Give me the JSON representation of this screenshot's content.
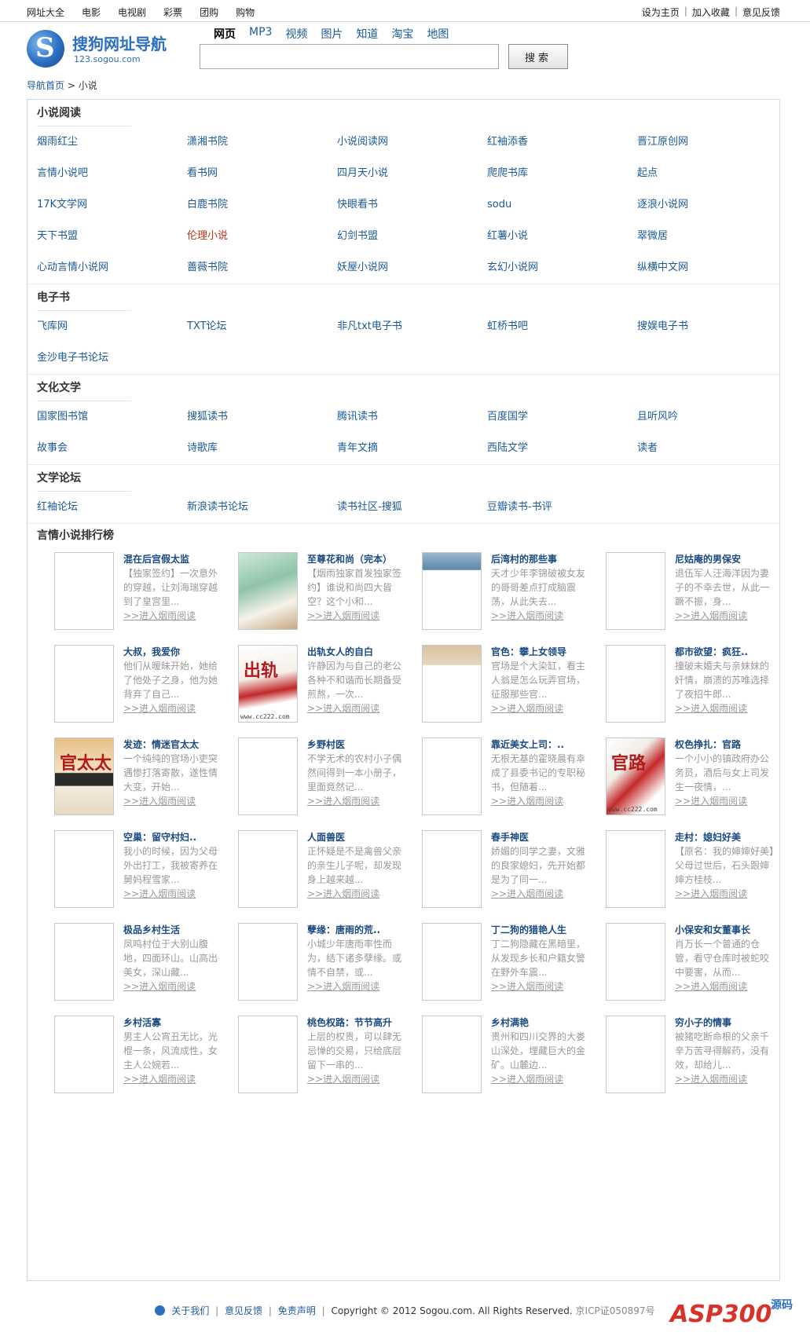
{
  "topnav": {
    "left": [
      "网址大全",
      "电影",
      "电视剧",
      "彩票",
      "团购",
      "购物"
    ],
    "right": [
      "设为主页",
      "加入收藏",
      "意见反馈"
    ],
    "separator": "|"
  },
  "logo": {
    "brand": "搜狗网址导航",
    "domain": "123.sogou.com",
    "glyph": "S"
  },
  "search": {
    "tabs": [
      "网页",
      "MP3",
      "视频",
      "图片",
      "知道",
      "淘宝",
      "地图"
    ],
    "active_tab": "网页",
    "value": "",
    "button": "搜索"
  },
  "breadcrumb": {
    "home": "导航首页",
    "arrow": ">",
    "current": "小说"
  },
  "sections": [
    {
      "title": "小说阅读",
      "links": [
        "烟雨红尘",
        "潇湘书院",
        "小说阅读网",
        "红袖添香",
        "晋江原创网",
        "言情小说吧",
        "看书网",
        "四月天小说",
        "爬爬书库",
        "起点",
        "17K文学网",
        "白鹿书院",
        "快眼看书",
        "sodu",
        "逐浪小说网",
        "天下书盟",
        "伦理小说",
        "幻剑书盟",
        "红薯小说",
        "翠微居",
        "心动言情小说网",
        "蔷薇书院",
        "妖屋小说网",
        "玄幻小说网",
        "纵横中文网"
      ],
      "hot": [
        16
      ]
    },
    {
      "title": "电子书",
      "links": [
        "飞库网",
        "TXT论坛",
        "非凡txt电子书",
        "虹桥书吧",
        "搜娱电子书",
        "金沙电子书论坛"
      ],
      "hot": []
    },
    {
      "title": "文化文学",
      "links": [
        "国家图书馆",
        "搜狐读书",
        "腾讯读书",
        "百度国学",
        "且听风吟",
        "故事会",
        "诗歌库",
        "青年文摘",
        "西陆文学",
        "读者"
      ],
      "hot": []
    },
    {
      "title": "文学论坛",
      "links": [
        "红袖论坛",
        "新浪读书论坛",
        "读书社区-搜狐",
        "豆瓣读书-书评"
      ],
      "hot": []
    }
  ],
  "ranking": {
    "title": "言情小说排行榜",
    "more_label": ">>进入烟雨阅读",
    "books": [
      {
        "title": "混在后宫假太监",
        "desc": "【独家签约】一次意外的穿越，让刘海瑞穿越到了皇宫里...",
        "cover": ""
      },
      {
        "title": "至尊花和尚（完本）",
        "desc": "【烟雨独家首发独家签约】谁说和尚四大皆空？这个小和...",
        "cover": "img-a"
      },
      {
        "title": "后湾村的那些事",
        "desc": "天才少年李锦破被女友的哥哥差点打成脑震荡，从此失去...",
        "cover": "img-b"
      },
      {
        "title": "尼姑庵的男保安",
        "desc": "退伍军人汪海洋因为妻子的不幸去世，从此一蹶不振，身...",
        "cover": ""
      },
      {
        "title": "大叔，我爱你",
        "desc": "他们从暧昧开始，她给了他处子之身，他为她背弃了自己...",
        "cover": ""
      },
      {
        "title": "出轨女人的自白",
        "desc": "许静因为与自己的老公各种不和谐而长期备受煎熬，一次...",
        "cover": "img-c",
        "label": "www.cc222.com",
        "mark": "出轨"
      },
      {
        "title": "官色：攀上女领导",
        "desc": "官场是个大染缸，看主人翁是怎么玩弄官场，征服那些官...",
        "cover": "img-d"
      },
      {
        "title": "都市欲望：疯狂..",
        "desc": "撞破未婚夫与亲妹妹的奸情，崩溃的苏唯选择了夜招牛郎...",
        "cover": ""
      },
      {
        "title": "发迹：情迷官太太",
        "desc": "一个纯纯的官场小吏突遇惨打落寄散，遂性情大变，开始...",
        "cover": "img-e",
        "mark": "官太太"
      },
      {
        "title": "乡野村医",
        "desc": "不学无术的农村小子偶然间得到一本小册子，里面竟然记...",
        "cover": ""
      },
      {
        "title": "靠近美女上司：..",
        "desc": "无根无基的霍晓晨有幸成了县委书记的专职秘书，但随着...",
        "cover": ""
      },
      {
        "title": "权色挣扎：官路",
        "desc": "一个小小的镇政府办公务员，酒后与女上司发生一夜情，...",
        "cover": "img-f",
        "label": "www.cc222.com",
        "mark": "官路"
      },
      {
        "title": "空巢：留守村妇..",
        "desc": "我小的时候，因为父母外出打工，我被寄养在舅妈程雪家...",
        "cover": ""
      },
      {
        "title": "人面兽医",
        "desc": "正怀疑是不是禽兽父亲的亲生儿子呢，却发现身上越来越...",
        "cover": ""
      },
      {
        "title": "春手神医",
        "desc": "娇媚的同学之妻，文雅的良家媳妇，先开始都是为了同一...",
        "cover": ""
      },
      {
        "title": "走村：媳妇好美",
        "desc": "【原名：我的婶婶好美】父母过世后，石头跟婶婶方桂枝...",
        "cover": ""
      },
      {
        "title": "极品乡村生活",
        "desc": "凤鸣村位于大别山腹地，四面环山。山高出美女，深山藏...",
        "cover": ""
      },
      {
        "title": "孽缘：唐雨的荒..",
        "desc": "小城少年唐雨率性而为，结下诸多孽缘。或情不自禁，或...",
        "cover": ""
      },
      {
        "title": "丁二狗的猎艳人生",
        "desc": "丁二狗隐藏在黑暗里，从发现乡长和户籍女警在野外车震...",
        "cover": ""
      },
      {
        "title": "小保安和女董事长",
        "desc": "肖万长一个普通的仓管，看守仓库时被蛇咬中要害，从而...",
        "cover": ""
      },
      {
        "title": "乡村活寡",
        "desc": "男主人公宵丑无比，光棍一条，风流成性，女主人公婉若...",
        "cover": ""
      },
      {
        "title": "桃色权路：节节高升",
        "desc": "上层的权贵，可以肆无忌惮的交易，只给底层留下一串的...",
        "cover": ""
      },
      {
        "title": "乡村满艳",
        "desc": "贵州和四川交界的大娄山深处，埋藏巨大的金矿。山麓边...",
        "cover": ""
      },
      {
        "title": "穷小子的情事",
        "desc": "被猪吃断命根的父亲千辛万苦寻得解药，没有效，却给儿...",
        "cover": ""
      }
    ]
  },
  "footer": {
    "links": [
      "关于我们",
      "意见反馈",
      "免责声明"
    ],
    "copyright": "Copyright © 2012 Sogou.com. All Rights Reserved.",
    "icp": "京ICP证050897号"
  },
  "watermark": {
    "brand": "ASP300",
    "suffix": "源码"
  }
}
